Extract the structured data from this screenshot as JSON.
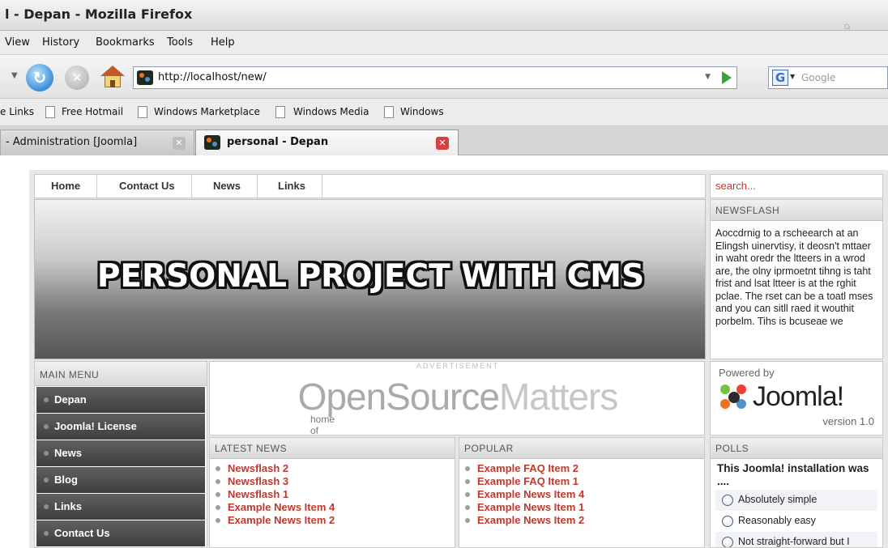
{
  "window": {
    "title": "l - Depan - Mozilla Firefox",
    "corner_glyph": "9"
  },
  "menubar": [
    "View",
    "History",
    "Bookmarks",
    "Tools",
    "Help"
  ],
  "navbar": {
    "url": "http://localhost/new/",
    "search_placeholder": "Google",
    "search_engine_glyph": "G"
  },
  "bookmarks": [
    {
      "label": "e Links",
      "icon": "none"
    },
    {
      "label": "Free Hotmail",
      "icon": "page-icon"
    },
    {
      "label": "Windows Marketplace",
      "icon": "page-icon"
    },
    {
      "label": "Windows Media",
      "icon": "page-icon"
    },
    {
      "label": "Windows",
      "icon": "page-icon"
    }
  ],
  "tabs": [
    {
      "label": "- Administration [Joomla]",
      "active": false
    },
    {
      "label": "personal - Depan",
      "active": true
    }
  ],
  "site": {
    "top_menu": [
      "Home",
      "Contact Us",
      "News",
      "Links"
    ],
    "search_placeholder": "search...",
    "banner_title": "PERSONAL PROJECT WITH CMS",
    "newsflash": {
      "heading": "NEWSFLASH",
      "text": "Aoccdrnig to a rscheearch at an Elingsh uinervtisy, it deosn't mttaer in waht oredr the ltteers in a wrod are, the olny iprmoetnt tihng is taht frist and lsat ltteer is at the rghit pclae. The rset can be a toatl mses and you can sitll raed it wouthit porbelm. Tihs is bcuseae we"
    },
    "main_menu": {
      "heading": "MAIN MENU",
      "items": [
        "Depan",
        "Joomla! License",
        "News",
        "Blog",
        "Links",
        "Contact Us"
      ]
    },
    "advertisement": {
      "label": "ADVERTISEMENT",
      "brand_a": "OpenSource",
      "brand_b": "Matters",
      "tagline": "home of Joomla!"
    },
    "powered": {
      "label": "Powered by",
      "brand": "Joomla!",
      "version": "version 1.0"
    },
    "latest_news": {
      "heading": "LATEST NEWS",
      "items": [
        "Newsflash 2",
        "Newsflash 3",
        "Newsflash 1",
        "Example News Item 4",
        "Example News Item 2"
      ]
    },
    "popular": {
      "heading": "POPULAR",
      "items": [
        "Example FAQ Item 2",
        "Example FAQ Item 1",
        "Example News Item 4",
        "Example News Item 1",
        "Example News Item 2"
      ]
    },
    "polls": {
      "heading": "POLLS",
      "question": "This Joomla! installation was ....",
      "options": [
        "Absolutely simple",
        "Reasonably easy",
        "Not straight-forward but I"
      ]
    }
  },
  "colors": {
    "link_red": "#c0392b",
    "menu_dark": "#444444",
    "joomla_orange": "#f26f21",
    "joomla_blue": "#5091cd",
    "joomla_green": "#7ac143",
    "joomla_red": "#ef4036"
  }
}
